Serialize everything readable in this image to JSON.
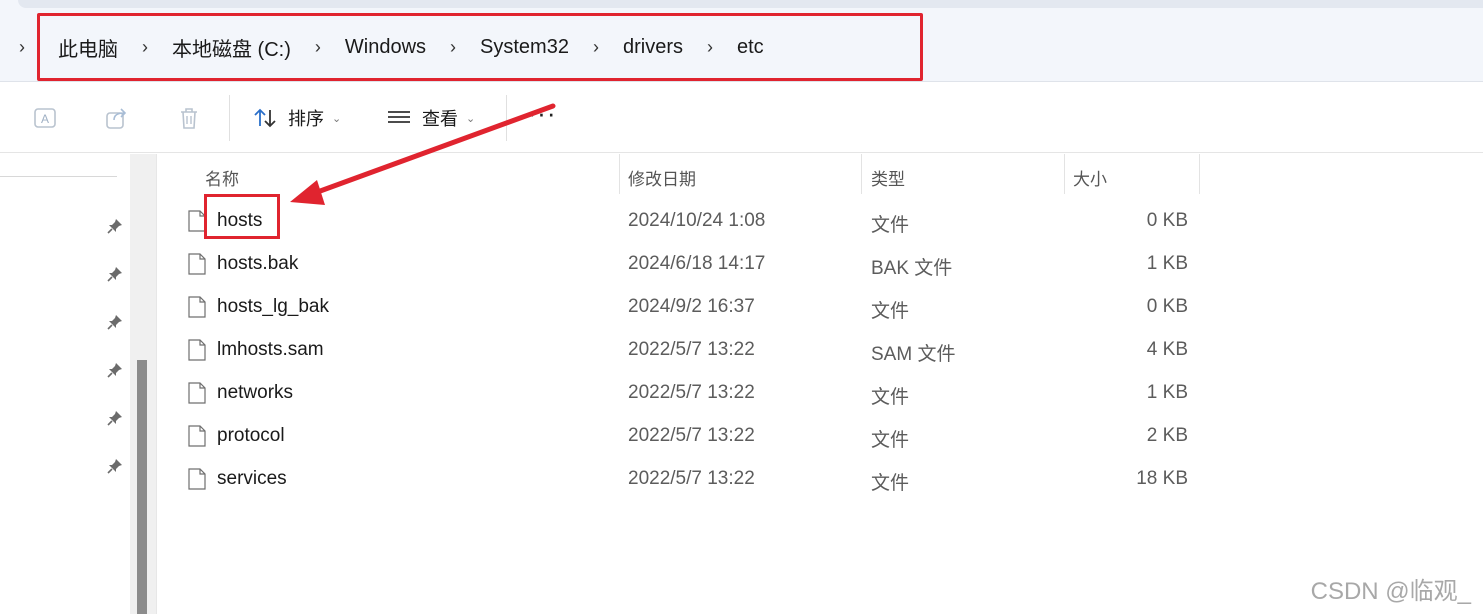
{
  "breadcrumb": {
    "items": [
      "此电脑",
      "本地磁盘 (C:)",
      "Windows",
      "System32",
      "drivers",
      "etc"
    ],
    "separator": "›",
    "lead": "›"
  },
  "toolbar": {
    "sort_label": "排序",
    "view_label": "查看",
    "caret": "⌄",
    "more": "···"
  },
  "columns": {
    "name": "名称",
    "date": "修改日期",
    "type": "类型",
    "size": "大小"
  },
  "files": [
    {
      "name": "hosts",
      "date": "2024/10/24 1:08",
      "type": "文件",
      "size": "0 KB"
    },
    {
      "name": "hosts.bak",
      "date": "2024/6/18 14:17",
      "type": "BAK 文件",
      "size": "1 KB"
    },
    {
      "name": "hosts_lg_bak",
      "date": "2024/9/2 16:37",
      "type": "文件",
      "size": "0 KB"
    },
    {
      "name": "lmhosts.sam",
      "date": "2022/5/7 13:22",
      "type": "SAM 文件",
      "size": "4 KB"
    },
    {
      "name": "networks",
      "date": "2022/5/7 13:22",
      "type": "文件",
      "size": "1 KB"
    },
    {
      "name": "protocol",
      "date": "2022/5/7 13:22",
      "type": "文件",
      "size": "2 KB"
    },
    {
      "name": "services",
      "date": "2022/5/7 13:22",
      "type": "文件",
      "size": "18 KB"
    }
  ],
  "watermark": "CSDN @临观_",
  "colors": {
    "annotation_red": "#e0242f",
    "accent_blue": "#2a6fc9"
  }
}
